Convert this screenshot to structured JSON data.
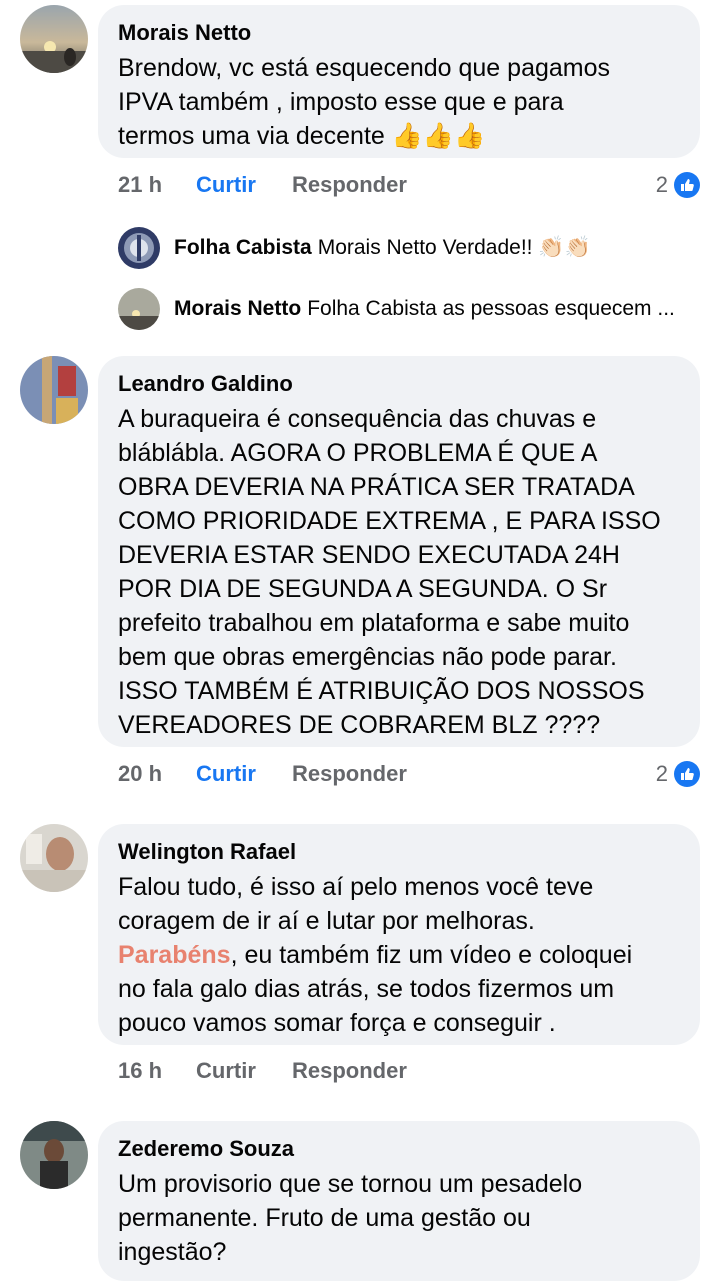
{
  "comments": [
    {
      "author": "Morais Netto",
      "text": "Brendow, vc está esquecendo que pagamos\nIPVA também , imposto esse que e para\ntermos uma via decente 👍👍👍",
      "time": "21 h",
      "like_label": "Curtir",
      "reply_label": "Responder",
      "reaction_count": "2",
      "liked": true,
      "replies": [
        {
          "author": "Folha Cabista",
          "text": "Morais Netto Verdade!! 👏🏻👏🏻"
        },
        {
          "author": "Morais Netto",
          "text": "Folha Cabista as pessoas esquecem ..."
        }
      ]
    },
    {
      "author": "Leandro Galdino",
      "text": "A buraqueira é consequência das chuvas e\nbláblábla. AGORA O PROBLEMA É QUE A\nOBRA DEVERIA NA PRÁTICA SER TRATADA\nCOMO PRIORIDADE EXTREMA , E PARA ISSO\nDEVERIA ESTAR SENDO EXECUTADA 24H\nPOR DIA DE SEGUNDA A SEGUNDA. O Sr\nprefeito trabalhou em plataforma e sabe muito\nbem que obras emergências não pode parar.\nISSO TAMBÉM É ATRIBUIÇÃO DOS NOSSOS\nVEREADORES DE COBRAREM BLZ ????",
      "time": "20 h",
      "like_label": "Curtir",
      "reply_label": "Responder",
      "reaction_count": "2",
      "liked": true
    },
    {
      "author": "Welington Rafael",
      "text_before": "Falou tudo, é isso aí pelo menos você teve\ncoragem de ir aí e lutar por melhoras.\n",
      "text_highlight": "Parabéns",
      "text_after": ", eu também fiz um vídeo e coloquei\nno fala galo dias atrás, se todos fizermos um\npouco vamos somar força e conseguir .",
      "time": "16 h",
      "like_label": "Curtir",
      "reply_label": "Responder",
      "liked": false
    },
    {
      "author": "Zederemo Souza",
      "text": "Um provisorio que se tornou um pesadelo\npermanente. Fruto de uma gestão ou\ningestão?"
    }
  ],
  "colors": {
    "accent": "#1877f2",
    "bubble": "#f0f2f5",
    "meta": "#65676b",
    "highlight": "#e8826f"
  }
}
